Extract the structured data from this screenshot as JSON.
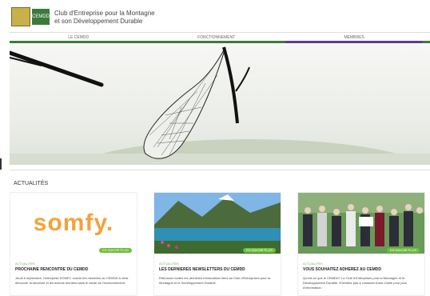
{
  "header": {
    "brand_line1": "Club d'Entreprise pour la Montagne",
    "brand_line2": "et son Développement Durable",
    "logo2_text": "CEMDD"
  },
  "nav": {
    "items": [
      {
        "label": "LE CEMDD"
      },
      {
        "label": "FONCTIONNEMENT"
      },
      {
        "label": "MEMBRES"
      }
    ]
  },
  "section": {
    "title": "ACTUALITÉS"
  },
  "cards": [
    {
      "image_text": "somfy.",
      "badge": "EN SAVOIR PLUS",
      "category": "ACTUALITÉS",
      "title": "PROCHAINE RENCONTRE DU CEMDD",
      "text": "Jeudi 8 septembre, l'entreprise SOMFY, convie les membres du CEMDD à venir découvrir la structure et les actions menées dans le cadre de l'environnement."
    },
    {
      "badge": "EN SAVOIR PLUS",
      "category": "ACTUALITÉS",
      "title": "LES DERNIERES NEWSLETTERS DU CEMDD",
      "text": "Retrouvez toutes les dernières informations liées au Club d'Entreprises pour la Montagne et le Développement Durable."
    },
    {
      "badge": "EN SAVOIR PLUS",
      "category": "ACTUALITÉS",
      "title": "VOUS SOUHAITEZ ADHEREZ AU CEMDD",
      "text": "Qu'est-ce que le CEMDD? Le Club d'Entreprises pour la Montagne et le Développement Durable. N'hésitez pas à contacter Anne-Claire pour plus d'information."
    }
  ]
}
